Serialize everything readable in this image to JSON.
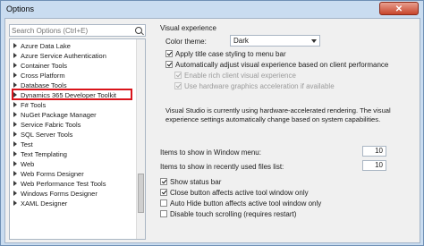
{
  "window": {
    "title": "Options",
    "close_label": "✕"
  },
  "search": {
    "placeholder": "Search Options (Ctrl+E)"
  },
  "tree": {
    "items": [
      {
        "label": "Azure Data Lake"
      },
      {
        "label": "Azure Service Authentication"
      },
      {
        "label": "Container Tools"
      },
      {
        "label": "Cross Platform"
      },
      {
        "label": "Database Tools"
      },
      {
        "label": "Dynamics 365 Developer Toolkit",
        "highlighted": true
      },
      {
        "label": "F# Tools"
      },
      {
        "label": "NuGet Package Manager"
      },
      {
        "label": "Service Fabric Tools"
      },
      {
        "label": "SQL Server Tools"
      },
      {
        "label": "Test"
      },
      {
        "label": "Text Templating"
      },
      {
        "label": "Web"
      },
      {
        "label": "Web Forms Designer"
      },
      {
        "label": "Web Performance Test Tools"
      },
      {
        "label": "Windows Forms Designer"
      },
      {
        "label": "XAML Designer"
      }
    ]
  },
  "visual": {
    "group_title": "Visual experience",
    "theme_label": "Color theme:",
    "theme_value": "Dark",
    "options": [
      {
        "label": "Apply title case styling to menu bar",
        "checked": true,
        "enabled": true
      },
      {
        "label": "Automatically adjust visual experience based on client performance",
        "checked": true,
        "enabled": true
      },
      {
        "label": "Enable rich client visual experience",
        "checked": true,
        "enabled": false
      },
      {
        "label": "Use hardware graphics acceleration if available",
        "checked": true,
        "enabled": false
      }
    ],
    "status_text": "Visual Studio is currently using hardware-accelerated rendering. The visual experience settings automatically change based on system capabilities."
  },
  "counts": {
    "window_menu_label": "Items to show in Window menu:",
    "window_menu_value": "10",
    "recent_files_label": "Items to show in recently used files list:",
    "recent_files_value": "10"
  },
  "misc_options": [
    {
      "label": "Show status bar",
      "checked": true
    },
    {
      "label": "Close button affects active tool window only",
      "checked": true
    },
    {
      "label": "Auto Hide button affects active tool window only",
      "checked": false
    },
    {
      "label": "Disable touch scrolling (requires restart)",
      "checked": false
    }
  ]
}
